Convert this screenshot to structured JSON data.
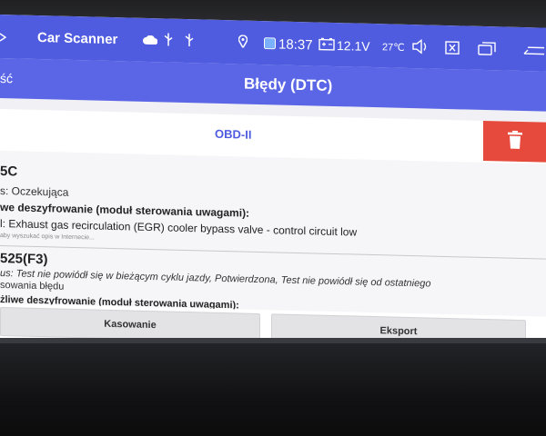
{
  "status_bar": {
    "app_name": "Car Scanner",
    "time": "18:37",
    "voltage": "12.1V",
    "temperature": "27℃",
    "icons": [
      "cloud-icon",
      "usb-icon",
      "usb-icon",
      "location-icon",
      "battery-icon",
      "volume-icon",
      "close-box-icon",
      "recent-apps-icon",
      "back-arrow-icon"
    ]
  },
  "app_bar": {
    "back_label": "ść",
    "title": "Błędy (DTC)"
  },
  "tabs": {
    "active": "OBD-II"
  },
  "dtc_list": [
    {
      "code": "5C",
      "status": "s: Oczekująca",
      "heading": "we deszyfrowanie (moduł sterowania uwagami):",
      "description": "l: Exhaust gas recirculation (EGR) cooler bypass valve - control circuit low",
      "hint": "aby wyszukać opis w Internecie..."
    },
    {
      "code": "525(F3)",
      "status": "us: Test nie powiódł się w bieżącym cyklu jazdy, Potwierdzona, Test nie powiódł się od ostatniego",
      "status_cont": "sowania błędu",
      "heading": "żliwe deszyfrowanie (moduł sterowania uwagami):"
    }
  ],
  "actions": {
    "clear_label": "Kasowanie",
    "export_label": "Eksport"
  },
  "colors": {
    "status_bar": "#4f5ce0",
    "app_bar": "#5a66e6",
    "delete_button": "#e64a3c",
    "tab_text": "#4f5ce0"
  }
}
